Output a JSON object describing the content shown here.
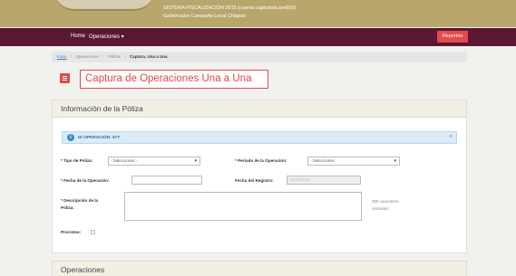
{
  "header": {
    "system_title": "SISTEMA FISCALIZACIÓN 2015 (cuenta capturista.pre603)",
    "subtitle": "Gobernador Campaña Local Chiapas",
    "colors": {
      "topbar": "#b9a66c",
      "navbar": "#5a1736",
      "accent": "#e24848"
    }
  },
  "nav": {
    "home": "Home",
    "operaciones": "Operaciones ▾",
    "reportes": "Reportes"
  },
  "breadcrumb": {
    "items": [
      "Inicio",
      "Operaciones",
      "Pólizas"
    ],
    "current": "Captura, Una a Una",
    "separator": "/"
  },
  "page": {
    "title": "Captura de Operaciones Una a Una",
    "menu_icon": "hamburger-menu-icon"
  },
  "poliza_panel": {
    "title": "Información de la Póliza",
    "alert": {
      "icon": "info-icon",
      "icon_glyph": "i",
      "text": "ID OPERACIÓN: 677",
      "close": "×"
    },
    "tipo_poliza": {
      "label": "* Tipo de Póliza:",
      "value": "- Seleccionar -"
    },
    "periodo": {
      "label": "* Periodo de la Operación:",
      "value": "- Seleccionar -"
    },
    "fecha_operacion": {
      "label": "* Fecha de la Operación:",
      "value": ""
    },
    "fecha_registro": {
      "label": "Fecha del Registro:",
      "value": "22/10/2015"
    },
    "descripcion": {
      "label_line1": "* Descripción de la",
      "label_line2": "Póliza:",
      "value": "",
      "hint_line1": "300 caracteres",
      "hint_line2": "restantes."
    },
    "prorrateo": {
      "label": "Prorrateo:",
      "checked": false
    }
  },
  "operaciones_panel": {
    "title": "Operaciones"
  }
}
